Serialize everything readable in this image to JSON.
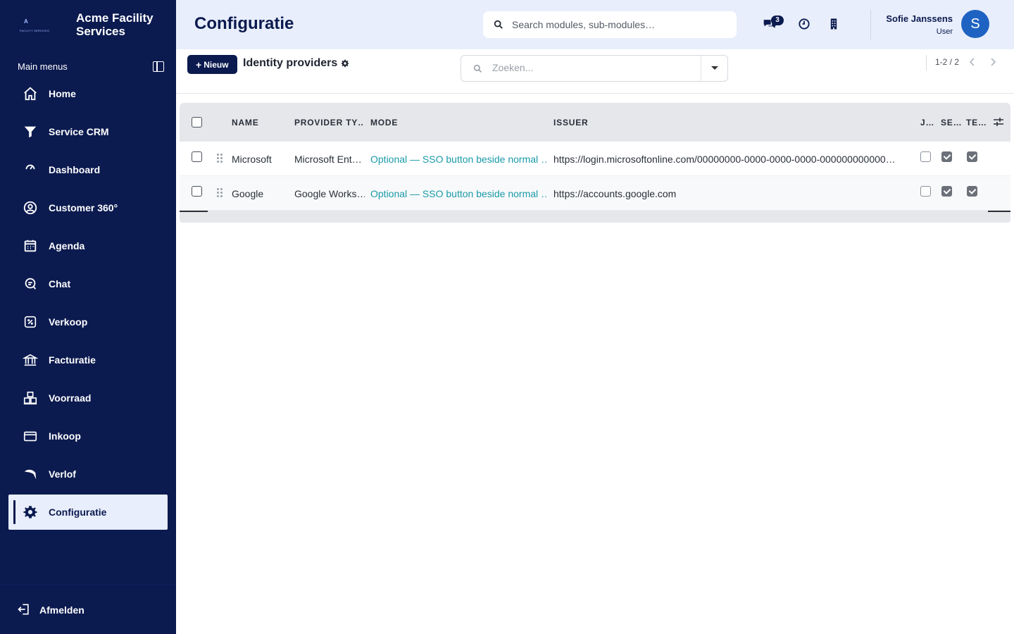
{
  "brand": {
    "logo_letter": "A",
    "logo_tagline": "FACILITY SERVICES",
    "name": "Acme Facility Services"
  },
  "sidebar": {
    "section_label": "Main menus",
    "items": [
      {
        "label": "Home",
        "icon": "home-icon"
      },
      {
        "label": "Service CRM",
        "icon": "funnel-icon"
      },
      {
        "label": "Dashboard",
        "icon": "gauge-icon"
      },
      {
        "label": "Customer 360°",
        "icon": "user-circle-icon"
      },
      {
        "label": "Agenda",
        "icon": "calendar-icon"
      },
      {
        "label": "Chat",
        "icon": "chat-icon"
      },
      {
        "label": "Verkoop",
        "icon": "percent-icon"
      },
      {
        "label": "Facturatie",
        "icon": "bank-icon"
      },
      {
        "label": "Voorraad",
        "icon": "boxes-icon"
      },
      {
        "label": "Inkoop",
        "icon": "credit-card-icon"
      },
      {
        "label": "Verlof",
        "icon": "plane-icon"
      },
      {
        "label": "Configuratie",
        "icon": "gear-icon",
        "active": true
      }
    ],
    "logout_label": "Afmelden"
  },
  "topbar": {
    "title": "Configuratie",
    "search_placeholder": "Search modules, sub-modules…",
    "chat_badge": "3",
    "user_name": "Sofie Janssens",
    "user_role": "User",
    "avatar_initial": "S"
  },
  "control": {
    "new_label": "Nieuw",
    "breadcrumb": "Identity providers",
    "search_placeholder": "Zoeken...",
    "pager_value": "1-2 / 2"
  },
  "table": {
    "columns": {
      "name": "NAME",
      "provider_type": "PROVIDER TY…",
      "mode": "MODE",
      "issuer": "ISSUER",
      "j": "J…",
      "se": "SE…",
      "te": "TE…"
    },
    "rows": [
      {
        "name": "Microsoft",
        "provider_type": "Microsoft Ent…",
        "mode": "Optional — SSO button beside normal …",
        "issuer": "https://login.microsoftonline.com/00000000-0000-0000-0000-000000000000…",
        "j": false,
        "se": true,
        "te": true
      },
      {
        "name": "Google",
        "provider_type": "Google Works…",
        "mode": "Optional — SSO button beside normal …",
        "issuer": "https://accounts.google.com",
        "j": false,
        "se": true,
        "te": true
      }
    ]
  },
  "colors": {
    "sidebar_bg": "#0b1a4f",
    "topbar_bg": "#e8eefb",
    "accent_link": "#1a9aa8",
    "avatar_bg": "#1e63c2"
  }
}
